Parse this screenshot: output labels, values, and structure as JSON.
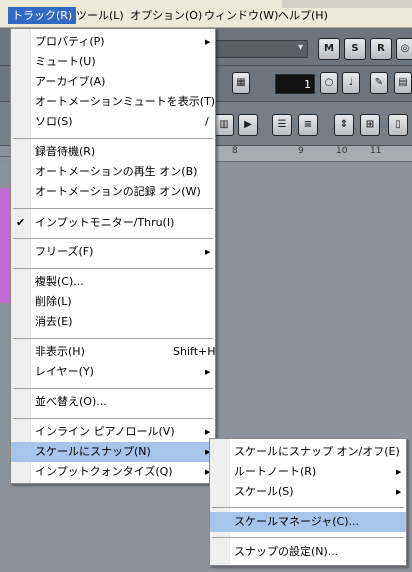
{
  "menubar": {
    "items": [
      {
        "label": "トラック(R)",
        "active": true
      },
      {
        "label": "ツール(L)",
        "active": false
      },
      {
        "label": "オプション(O)",
        "active": false
      },
      {
        "label": "ウィンドウ(W)",
        "active": false
      },
      {
        "label": "ヘルプ(H)",
        "active": false
      }
    ]
  },
  "toolbar": {
    "buttons": [
      "M",
      "S",
      "R"
    ],
    "counter_value": "1"
  },
  "ruler": {
    "ticks": [
      "8",
      "9",
      "10",
      "11"
    ]
  },
  "track_menu": {
    "items": [
      {
        "label": "プロパティ(P)",
        "shortcut": "",
        "submenu": true,
        "checked": false
      },
      {
        "label": "ミュート(U)",
        "shortcut": "",
        "submenu": false,
        "checked": false
      },
      {
        "label": "アーカイブ(A)",
        "shortcut": "",
        "submenu": false,
        "checked": false
      },
      {
        "label": "オートメーションミュートを表示(T)",
        "shortcut": "",
        "submenu": false,
        "checked": false
      },
      {
        "label": "ソロ(S)",
        "shortcut": "/",
        "submenu": false,
        "checked": false
      },
      {
        "label": "録音待機(R)",
        "shortcut": "",
        "submenu": false,
        "checked": false
      },
      {
        "label": "オートメーションの再生 オン(B)",
        "shortcut": "",
        "submenu": false,
        "checked": false
      },
      {
        "label": "オートメーションの記録 オン(W)",
        "shortcut": "",
        "submenu": false,
        "checked": false
      },
      {
        "label": "インプットモニター/Thru(I)",
        "shortcut": "",
        "submenu": false,
        "checked": true
      },
      {
        "label": "フリーズ(F)",
        "shortcut": "",
        "submenu": true,
        "checked": false
      },
      {
        "label": "複製(C)...",
        "shortcut": "",
        "submenu": false,
        "checked": false
      },
      {
        "label": "削除(L)",
        "shortcut": "",
        "submenu": false,
        "checked": false
      },
      {
        "label": "消去(E)",
        "shortcut": "",
        "submenu": false,
        "checked": false
      },
      {
        "label": "非表示(H)",
        "shortcut": "Shift+H",
        "submenu": false,
        "checked": false
      },
      {
        "label": "レイヤー(Y)",
        "shortcut": "",
        "submenu": true,
        "checked": false
      },
      {
        "label": "並べ替え(O)...",
        "shortcut": "",
        "submenu": false,
        "checked": false
      },
      {
        "label": "インライン ピアノロール(V)",
        "shortcut": "",
        "submenu": true,
        "checked": false
      },
      {
        "label": "スケールにスナップ(N)",
        "shortcut": "",
        "submenu": true,
        "checked": false,
        "highlighted": true
      },
      {
        "label": "インプットクォンタイズ(Q)",
        "shortcut": "",
        "submenu": true,
        "checked": false
      }
    ]
  },
  "snap_submenu": {
    "items": [
      {
        "label": "スケールにスナップ オン/オフ(E)",
        "submenu": false
      },
      {
        "label": "ルートノート(R)",
        "submenu": true
      },
      {
        "label": "スケール(S)",
        "submenu": true
      },
      {
        "label": "スケールマネージャ(C)...",
        "submenu": false,
        "highlighted": true
      },
      {
        "label": "スナップの設定(N)...",
        "submenu": false
      }
    ]
  },
  "colors": {
    "menu_highlight": "#a7c4e9",
    "menubar_active": "#316ac5",
    "track_purple": "#c26bd6"
  }
}
